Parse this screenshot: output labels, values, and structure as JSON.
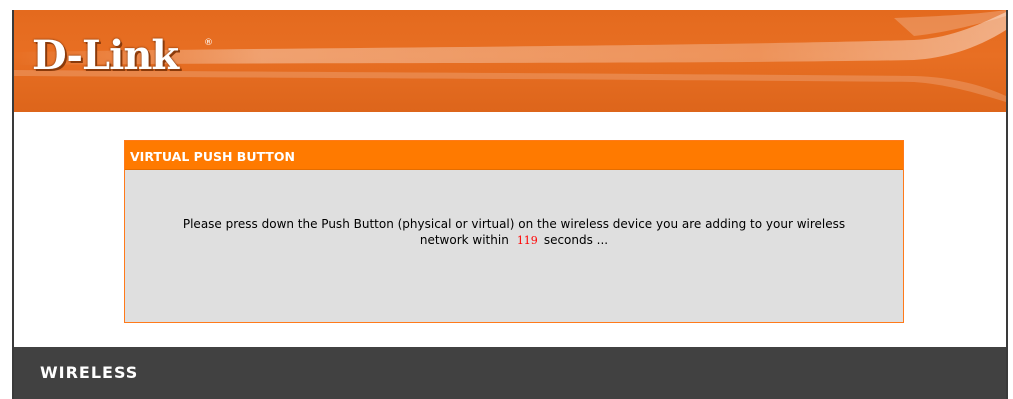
{
  "brand": {
    "logo_text": "D-Link",
    "registered_mark": "®"
  },
  "panel": {
    "title": "VIRTUAL PUSH BUTTON",
    "message_line1": "Please press down the Push Button (physical or virtual) on the wireless device you are adding to your wireless",
    "message_line2_prefix": "network within",
    "countdown_seconds": "119",
    "message_line2_suffix": "seconds ..."
  },
  "footer": {
    "label": "WIRELESS"
  },
  "colors": {
    "header_orange": "#e86f23",
    "panel_title_orange": "#ff7a00",
    "panel_background": "#dfdfdf",
    "footer_gray": "#414141",
    "countdown_red": "#ff0000"
  }
}
